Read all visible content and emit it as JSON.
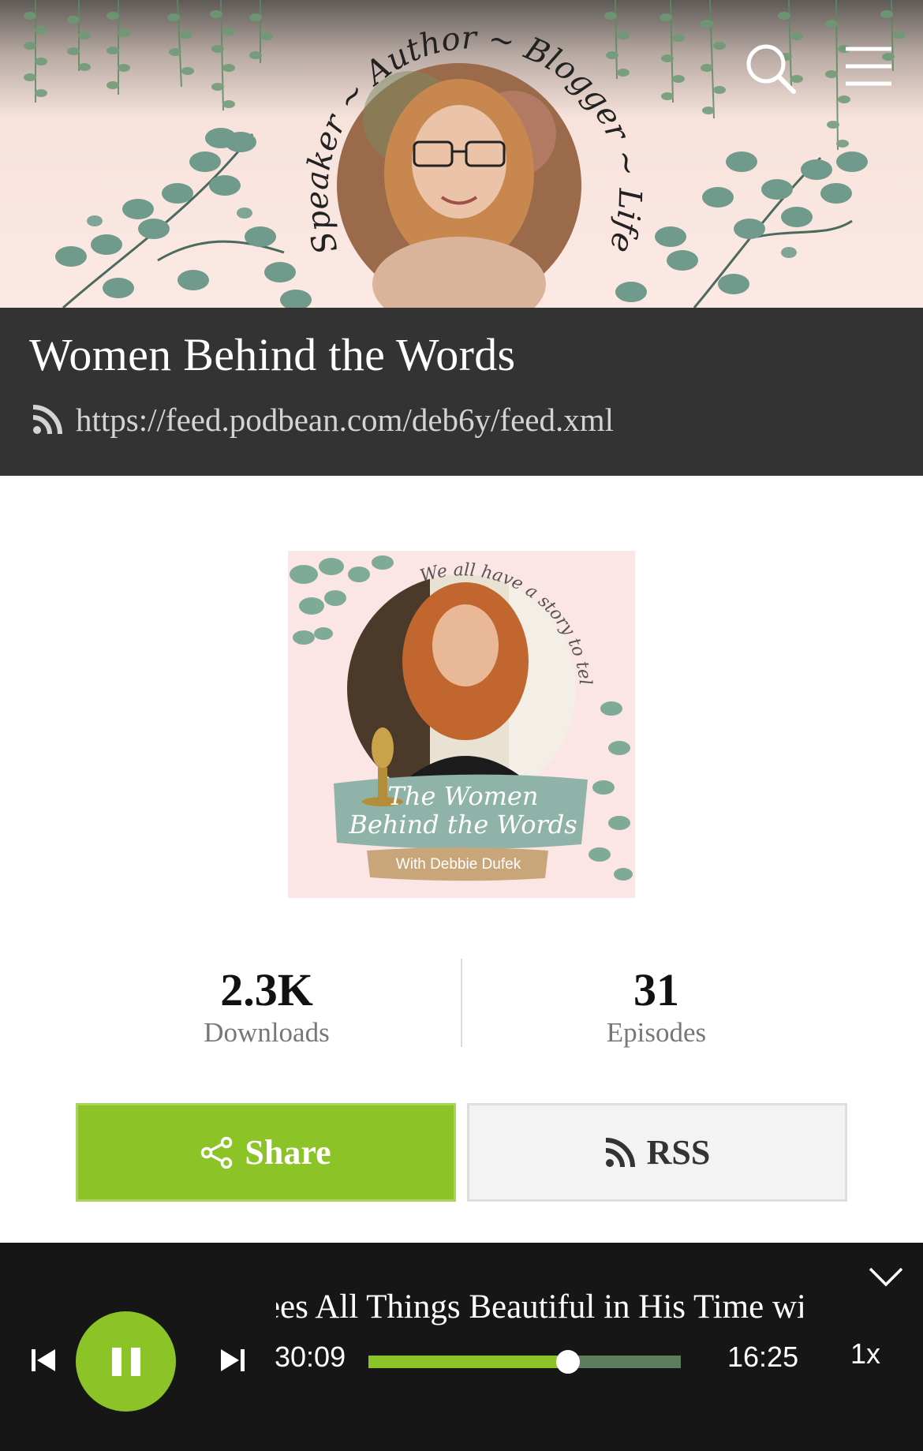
{
  "header": {
    "banner_arc_text": "Speaker ~ Author ~ Blogger ~ Life Coach",
    "icons": [
      "search-icon",
      "menu-icon"
    ]
  },
  "podcast": {
    "title": "Women Behind the Words",
    "feed_url": "https://feed.podbean.com/deb6y/feed.xml"
  },
  "cover": {
    "arc_text": "We all have a story to tell . . .",
    "title_line1": "The Women",
    "title_line2": "Behind the Words",
    "subtitle": "With Debbie Dufek"
  },
  "stats": {
    "downloads_value": "2.3K",
    "downloads_label": "Downloads",
    "episodes_value": "31",
    "episodes_label": "Episodes"
  },
  "actions": {
    "share_label": "Share",
    "rss_label": "RSS"
  },
  "player": {
    "episode_title": "Sees All Things Beautiful in His Time with M",
    "elapsed": "30:09",
    "remaining": "16:25",
    "speed": "1x",
    "progress": 0.64,
    "state": "playing"
  },
  "colors": {
    "accent": "#8cc326",
    "title_bar": "#333333",
    "player_bg": "#161616",
    "banner_bg": "#fde9e4"
  }
}
